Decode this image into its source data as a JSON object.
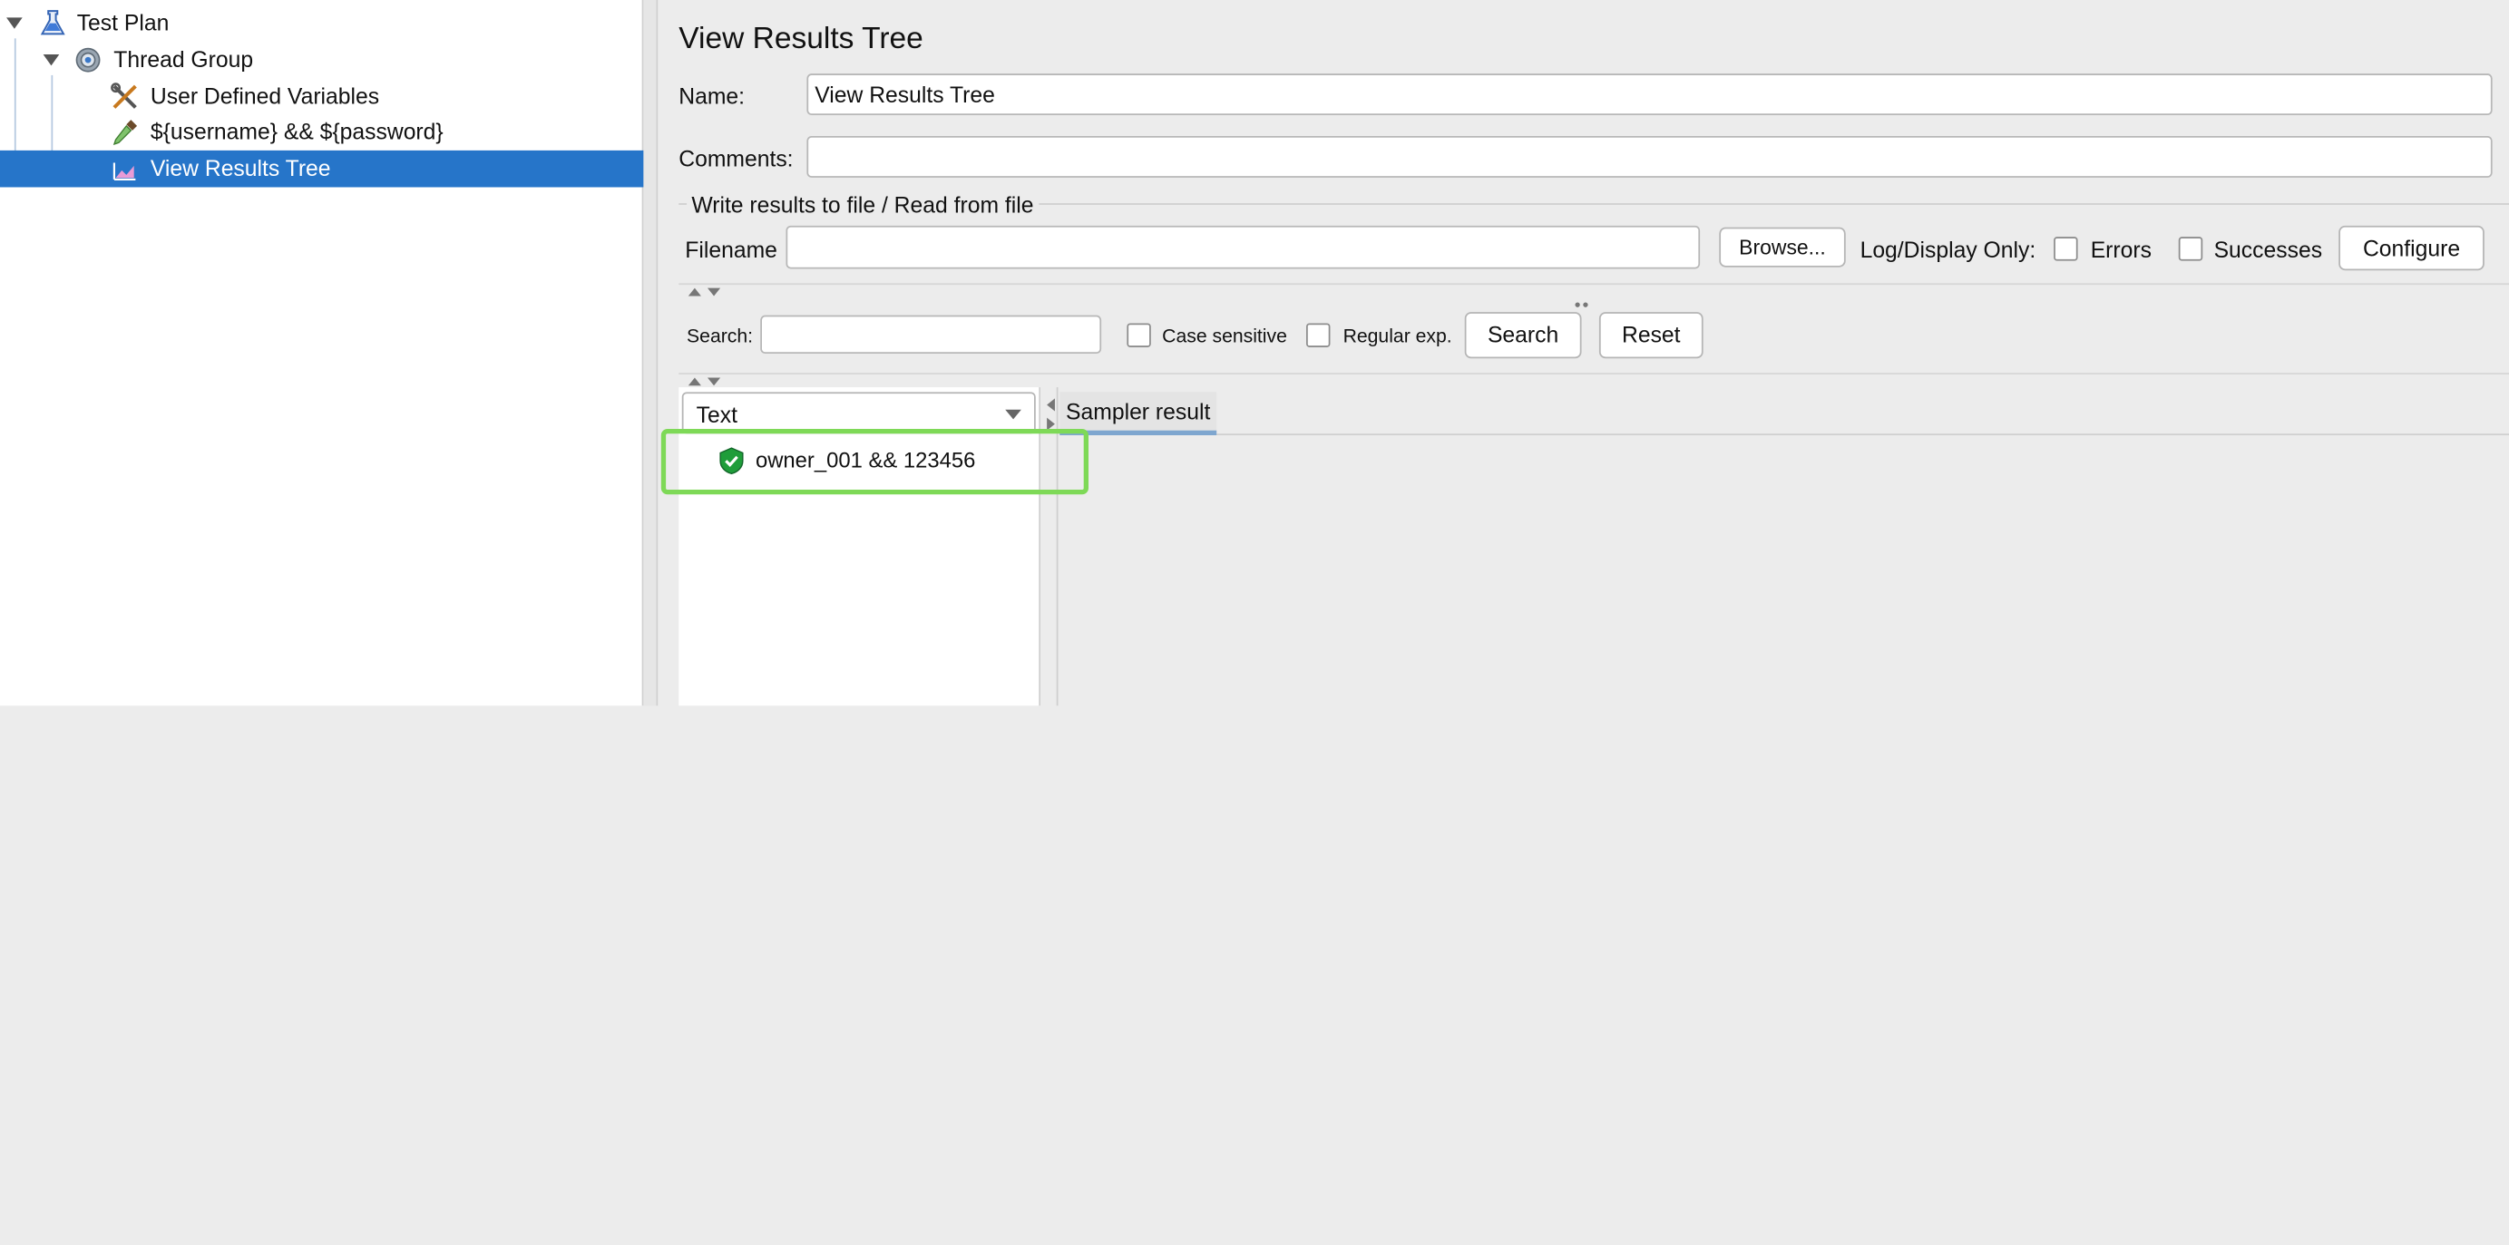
{
  "tree": {
    "items": [
      {
        "label": "Test Plan",
        "icon": "flask-icon"
      },
      {
        "label": "Thread Group",
        "icon": "gear-icon"
      },
      {
        "label": "User Defined Variables",
        "icon": "tools-icon"
      },
      {
        "label": "${username} && ${password}",
        "icon": "dropper-icon"
      },
      {
        "label": "View Results Tree",
        "icon": "chart-icon",
        "selected": true
      }
    ]
  },
  "panel": {
    "title": "View Results Tree",
    "name_label": "Name:",
    "name_value": "View Results Tree",
    "comments_label": "Comments:",
    "comments_value": "",
    "file_section": "Write results to file / Read from file",
    "filename_label": "Filename",
    "filename_value": "",
    "browse_label": "Browse...",
    "log_display_label": "Log/Display Only:",
    "errors_label": "Errors",
    "successes_label": "Successes",
    "configure_label": "Configure",
    "search_label": "Search:",
    "search_value": "",
    "case_sensitive_label": "Case sensitive",
    "regular_exp_label": "Regular exp.",
    "search_button": "Search",
    "reset_button": "Reset",
    "renderer_selected": "Text",
    "sampler_tab": "Sampler result",
    "result_item": "owner_001 && 123456"
  },
  "colors": {
    "selection": "#2675c9",
    "highlight_box": "#7ed957",
    "tab_underline": "#7ea6cf",
    "success_shield": "#1f9d3a"
  }
}
